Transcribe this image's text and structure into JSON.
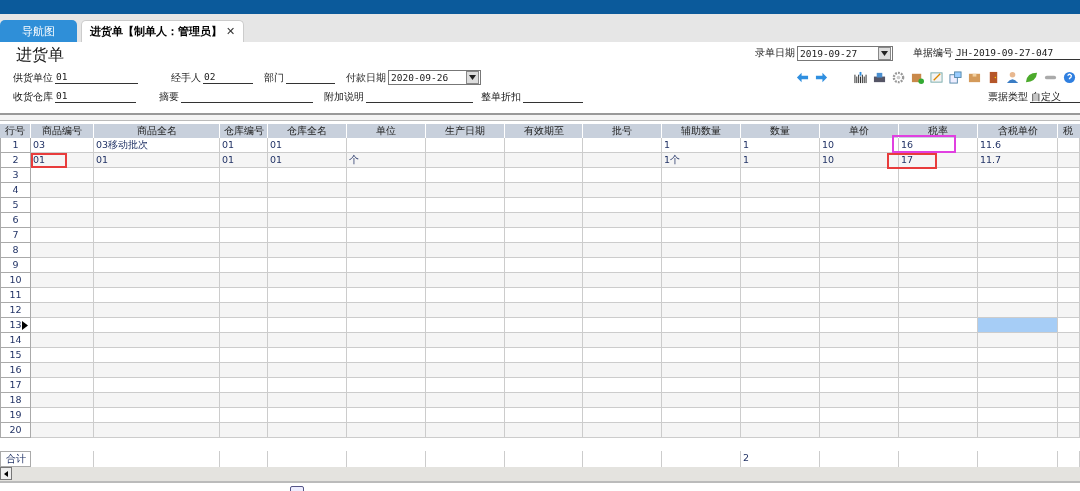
{
  "tabs": [
    {
      "label": "导航图",
      "selected": false
    },
    {
      "label": "进货单【制单人：管理员】",
      "selected": true,
      "close_label": "✕"
    }
  ],
  "form": {
    "title": "进货单",
    "header_fields": [
      {
        "label": "录单日期",
        "value": "2019-09-27",
        "kind": "dropdown"
      },
      {
        "label": "单据编号",
        "value": "JH-2019-09-27-047",
        "kind": "text"
      }
    ],
    "rows": [
      [
        {
          "label": "供货单位",
          "value": "01",
          "kind": "text"
        },
        {
          "label": "经手人",
          "value": "02",
          "kind": "text"
        },
        {
          "label": "部门",
          "kind": "text"
        },
        {
          "label": "付款日期",
          "value": "2020-09-26",
          "kind": "dropdown"
        }
      ],
      [
        {
          "label": "收货仓库",
          "value": "01",
          "kind": "text"
        },
        {
          "label": "摘要",
          "kind": "text"
        },
        {
          "label": "附加说明",
          "kind": "text"
        },
        {
          "label": "整单折扣",
          "kind": "text"
        }
      ]
    ],
    "bill_type": {
      "label": "票据类型",
      "value": "自定义"
    }
  },
  "table": {
    "columns": [
      "行号",
      "商品编号",
      "商品全名",
      "仓库编号",
      "仓库全名",
      "单位",
      "生产日期",
      "有效期至",
      "批号",
      "辅助数量",
      "数量",
      "单价",
      "税率",
      "含税单价",
      "税"
    ],
    "rows": [
      {
        "number": "1",
        "current": false,
        "cells": [
          {
            "text": "03"
          },
          {
            "text": "03移动批次"
          },
          {
            "text": "01"
          },
          {
            "text": "01"
          },
          {},
          {},
          {},
          {},
          {
            "text": "1"
          },
          {
            "text": "1"
          },
          {
            "text": "10"
          },
          {
            "text": "16",
            "color": "#e040e0"
          },
          {
            "text": "11.6"
          },
          {}
        ]
      },
      {
        "number": "2",
        "current": false,
        "cells": [
          {
            "text": "01",
            "color": "#e83c3c"
          },
          {
            "text": "01"
          },
          {
            "text": "01"
          },
          {
            "text": "01"
          },
          {
            "text": "个"
          },
          {},
          {},
          {},
          {
            "text": "1个"
          },
          {
            "text": "1"
          },
          {
            "text": "10"
          },
          {
            "text": "17",
            "color": "#e83c3c"
          },
          {
            "text": "11.7"
          },
          {}
        ]
      },
      {
        "number": "3",
        "current": false
      },
      {
        "number": "4",
        "current": false
      },
      {
        "number": "5",
        "current": false
      },
      {
        "number": "6",
        "current": false
      },
      {
        "number": "7",
        "current": false
      },
      {
        "number": "8",
        "current": false
      },
      {
        "number": "9",
        "current": false
      },
      {
        "number": "10",
        "current": false
      },
      {
        "number": "11",
        "current": false
      },
      {
        "number": "12",
        "current": false
      },
      {
        "number": "13",
        "current": true,
        "cells": [
          {
            "selected": false
          },
          {
            "selected": false
          },
          {
            "selected": false
          },
          {
            "selected": false
          },
          {
            "selected": false
          },
          {
            "selected": false
          },
          {
            "selected": false
          },
          {
            "selected": false
          },
          {
            "selected": false
          },
          {
            "selected": false
          },
          {
            "selected": false
          },
          {
            "selected": false
          },
          {
            "selected": true
          },
          {
            "selected": false
          }
        ]
      },
      {
        "number": "14",
        "current": false
      },
      {
        "number": "15",
        "current": false
      },
      {
        "number": "16",
        "current": false
      },
      {
        "number": "17",
        "current": false
      },
      {
        "number": "18",
        "current": false
      },
      {
        "number": "19",
        "current": false
      },
      {
        "number": "20",
        "current": false
      }
    ],
    "totals": {
      "label": "合计",
      "cells": [
        {},
        {},
        {},
        {},
        {},
        {},
        {},
        {},
        {},
        {
          "text": "2"
        },
        {},
        {},
        {},
        {}
      ]
    }
  }
}
